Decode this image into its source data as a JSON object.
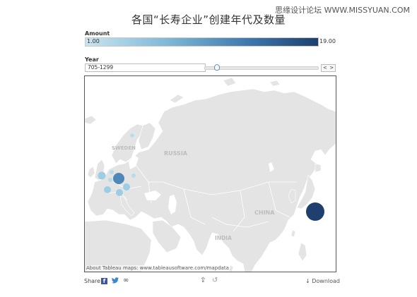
{
  "watermark": "思缘设计论坛 WWW.MISSYUAN.COM",
  "title": "各国“长寿企业”创建年代及数量",
  "legend": {
    "label": "Amount",
    "min": "1.00",
    "max": "19.00",
    "gradient_colors": [
      "#c9e4f0",
      "#7fb8d6",
      "#3f78ac",
      "#1f3f6e"
    ]
  },
  "year_filter": {
    "label": "Year",
    "value": "705-1299",
    "slider_position": 0.11,
    "prev_label": "<",
    "next_label": ">"
  },
  "map": {
    "labels": {
      "sweden": "SWEDEN",
      "russia": "RUSSIA",
      "china": "CHINA",
      "india": "INDIA"
    },
    "attribution": "About Tableau maps: www.tableausoftware.com/mapdata",
    "land_color": "#e4e4e4",
    "border_color": "#ffffff",
    "sea_color": "#ffffff"
  },
  "bubbles": [
    {
      "place": "Japan",
      "amount": 19,
      "color": "#1f3f6e"
    },
    {
      "place": "Germany",
      "amount": 6,
      "color": "#4f88b8"
    },
    {
      "place": "United Kingdom",
      "amount": 2,
      "color": "#9ccde4"
    },
    {
      "place": "France",
      "amount": 2,
      "color": "#9ccde4"
    },
    {
      "place": "Switzerland",
      "amount": 2,
      "color": "#9ccde4"
    },
    {
      "place": "Austria",
      "amount": 2,
      "color": "#9ccde4"
    },
    {
      "place": "Italy",
      "amount": 1,
      "color": "#b5dcea"
    },
    {
      "place": "Netherlands",
      "amount": 1,
      "color": "#b5dcea"
    },
    {
      "place": "Poland",
      "amount": 1,
      "color": "#b5dcea"
    },
    {
      "place": "Sweden",
      "amount": 1,
      "color": "#b5dcea"
    }
  ],
  "toolbar": {
    "share_label": "Share",
    "facebook_icon": "f",
    "twitter_icon": "twitter-bird",
    "link_icon": "∞",
    "export_icon": "⇪",
    "revert_icon": "↺",
    "download_label": "↓ Download"
  }
}
